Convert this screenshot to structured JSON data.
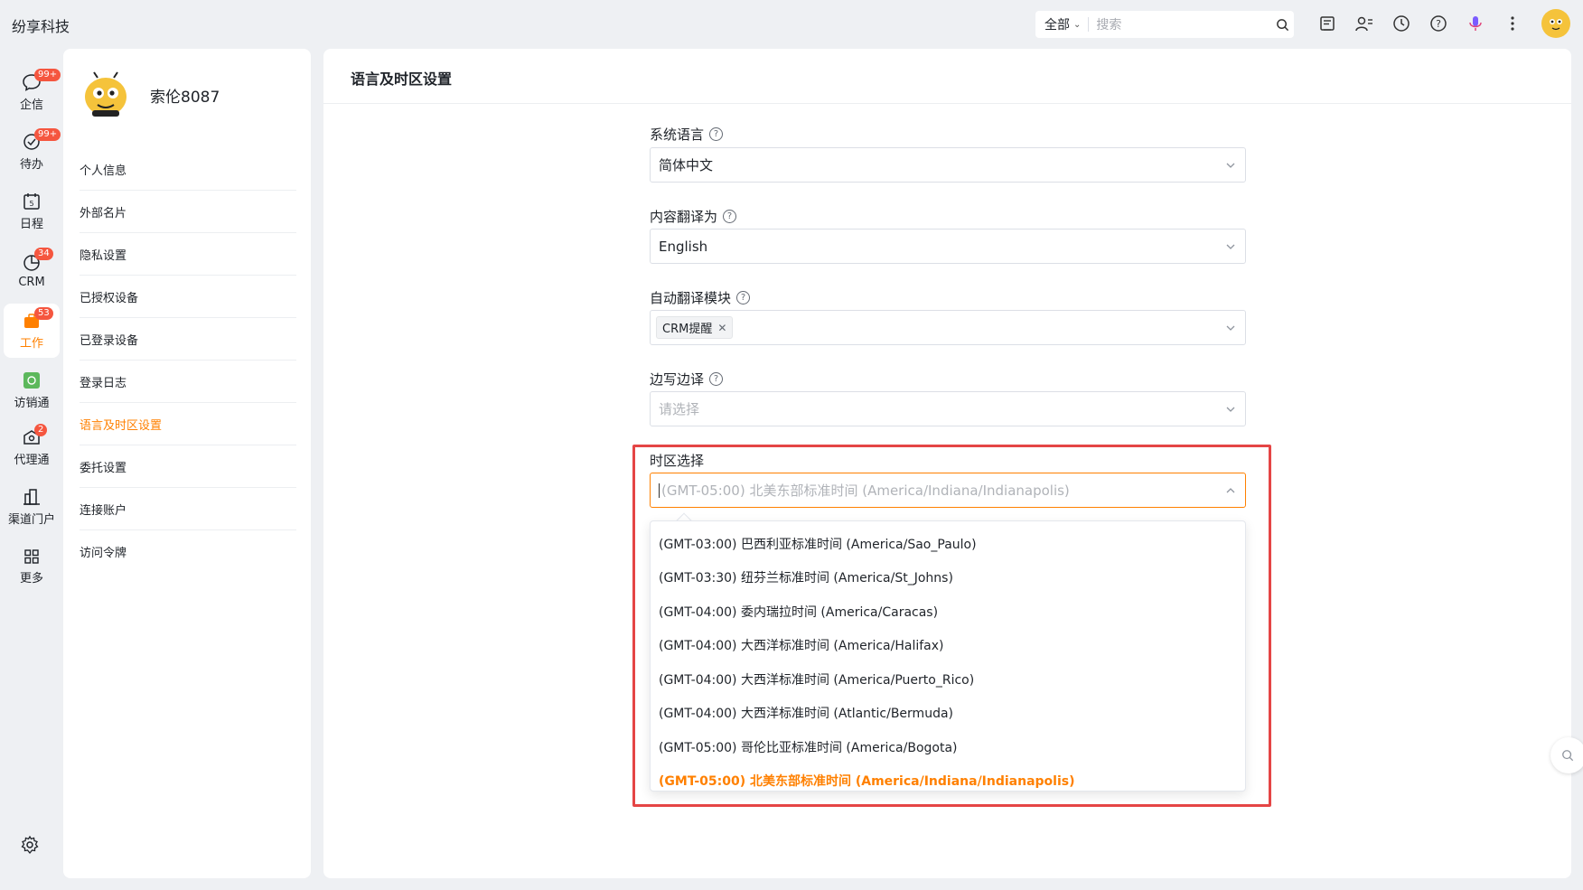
{
  "app": {
    "title": "纷享科技"
  },
  "search": {
    "scope": "全部",
    "placeholder": "搜索"
  },
  "topbar_icons": [
    "note-icon",
    "contacts-icon",
    "clock-icon",
    "help-icon",
    "voice-icon",
    "more-icon"
  ],
  "rail": {
    "items": [
      {
        "label": "企信",
        "badge": "99+",
        "icon": "chat-icon"
      },
      {
        "label": "待办",
        "badge": "99+",
        "icon": "check-circle-icon"
      },
      {
        "label": "日程",
        "badge": "",
        "icon": "calendar-icon"
      },
      {
        "label": "CRM",
        "badge": "34",
        "icon": "pie-icon"
      },
      {
        "label": "工作",
        "badge": "53",
        "icon": "briefcase-icon"
      },
      {
        "label": "访销通",
        "badge": "",
        "icon": "visit-icon"
      },
      {
        "label": "代理通",
        "badge": "2",
        "icon": "agent-icon"
      },
      {
        "label": "渠道门户",
        "badge": "",
        "icon": "building-icon"
      },
      {
        "label": "更多",
        "badge": "",
        "icon": "grid-icon"
      }
    ]
  },
  "profile": {
    "name": "索伦8087"
  },
  "subnav": {
    "items": [
      {
        "label": "个人信息"
      },
      {
        "label": "外部名片"
      },
      {
        "label": "隐私设置"
      },
      {
        "label": "已授权设备"
      },
      {
        "label": "已登录设备"
      },
      {
        "label": "登录日志"
      },
      {
        "label": "语言及时区设置"
      },
      {
        "label": "委托设置"
      },
      {
        "label": "连接账户"
      },
      {
        "label": "访问令牌"
      }
    ]
  },
  "main": {
    "title": "语言及时区设置",
    "fields": {
      "system_language": {
        "label": "系统语言",
        "value": "简体中文"
      },
      "translate_to": {
        "label": "内容翻译为",
        "value": "English"
      },
      "auto_translate": {
        "label": "自动翻译模块",
        "tag": "CRM提醒"
      },
      "side_translate": {
        "label": "边写边译",
        "placeholder": "请选择"
      },
      "timezone": {
        "label": "时区选择",
        "placeholder": "(GMT-05:00) 北美东部标准时间 (America/Indiana/Indianapolis)"
      }
    },
    "timezone_options": [
      "(GMT-03:00) 巴西利亚标准时间 (America/Sao_Paulo)",
      "(GMT-03:30) 纽芬兰标准时间 (America/St_Johns)",
      "(GMT-04:00) 委内瑞拉时间 (America/Caracas)",
      "(GMT-04:00) 大西洋标准时间 (America/Halifax)",
      "(GMT-04:00) 大西洋标准时间 (America/Puerto_Rico)",
      "(GMT-04:00) 大西洋标准时间 (Atlantic/Bermuda)",
      "(GMT-05:00) 哥伦比亚标准时间 (America/Bogota)",
      "(GMT-05:00) 北美东部标准时间 (America/Indiana/Indianapolis)"
    ],
    "selected_option_index": 7
  },
  "colors": {
    "accent": "#ff8000",
    "badge": "#f5563f",
    "highlight": "#e54545"
  }
}
